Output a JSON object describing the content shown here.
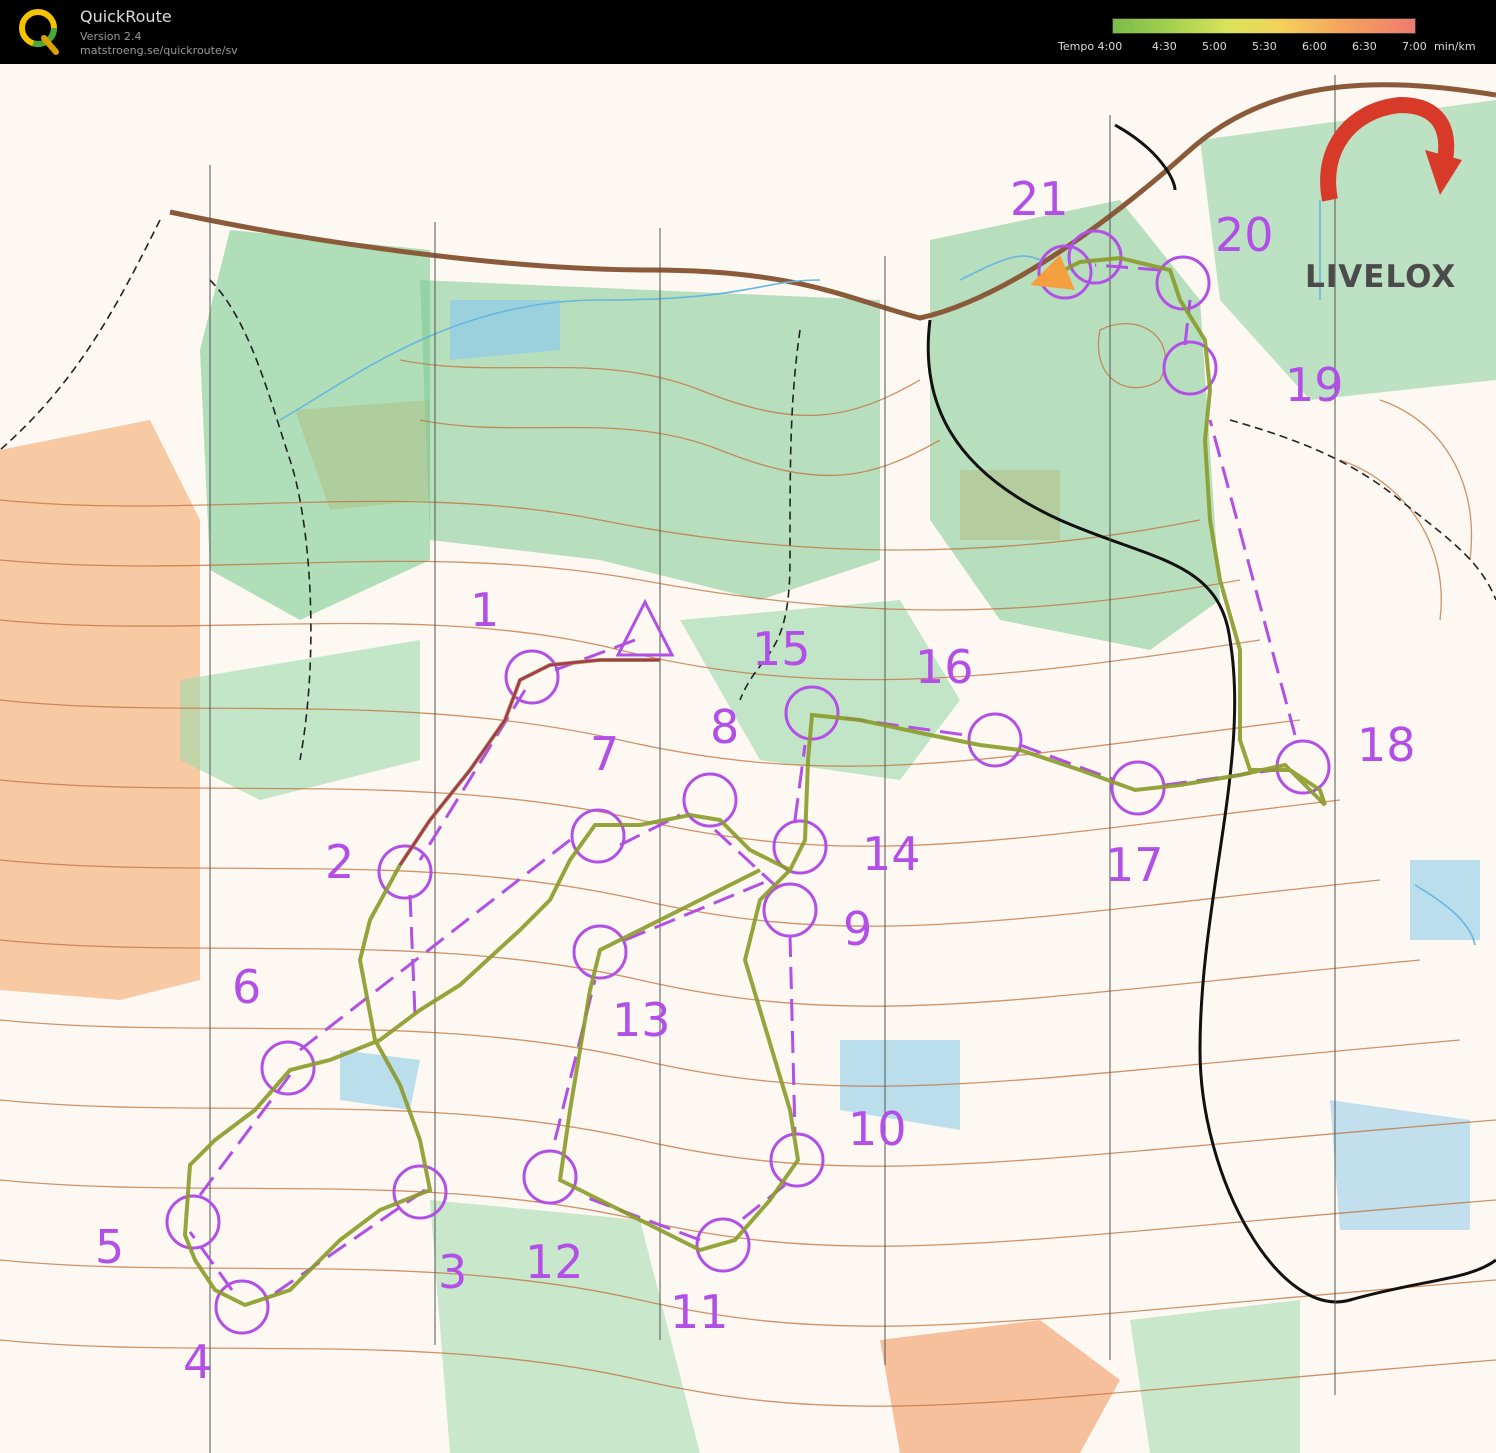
{
  "header": {
    "app_name": "QuickRoute",
    "version": "Version 2.4",
    "url": "matstroeng.se/quickroute/sv",
    "tempo_label": "Tempo 4:00",
    "tempo_ticks": [
      "4:30",
      "5:00",
      "5:30",
      "6:00",
      "6:30",
      "7:00"
    ],
    "tempo_unit": "min/km"
  },
  "brand": {
    "name": "LIVELOX"
  },
  "controls": [
    "1",
    "2",
    "3",
    "4",
    "5",
    "6",
    "7",
    "8",
    "9",
    "10",
    "11",
    "12",
    "13",
    "14",
    "15",
    "16",
    "17",
    "18",
    "19",
    "20",
    "21"
  ],
  "colors": {
    "course": "#b24fe6",
    "contour": "#c0703b",
    "forest": "#7dcb93",
    "open": "#f6b98a",
    "water": "#68b6e0",
    "route": "#8b9a2a"
  }
}
